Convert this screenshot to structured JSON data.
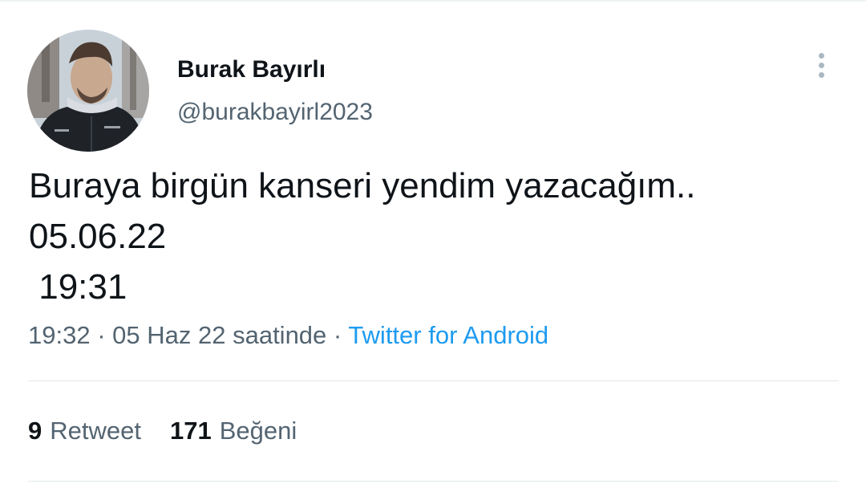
{
  "tweet": {
    "author": {
      "display_name": "Burak Bayırlı",
      "handle": "@burakbayirl2023"
    },
    "text": "Buraya birgün kanseri yendim yazacağım..\n05.06.22\n 19:31",
    "time": "19:32",
    "separator": "·",
    "date": "05 Haz 22 saatinde",
    "source": "Twitter for Android",
    "stats": {
      "retweets_count": "9",
      "retweets_label": "Retweet",
      "likes_count": "171",
      "likes_label": "Beğeni"
    }
  },
  "icons": {
    "more": "more-vertical-icon"
  },
  "colors": {
    "text_primary": "#0f1419",
    "text_secondary": "#536471",
    "link": "#1d9bf0",
    "divider": "#e1e8ed"
  }
}
